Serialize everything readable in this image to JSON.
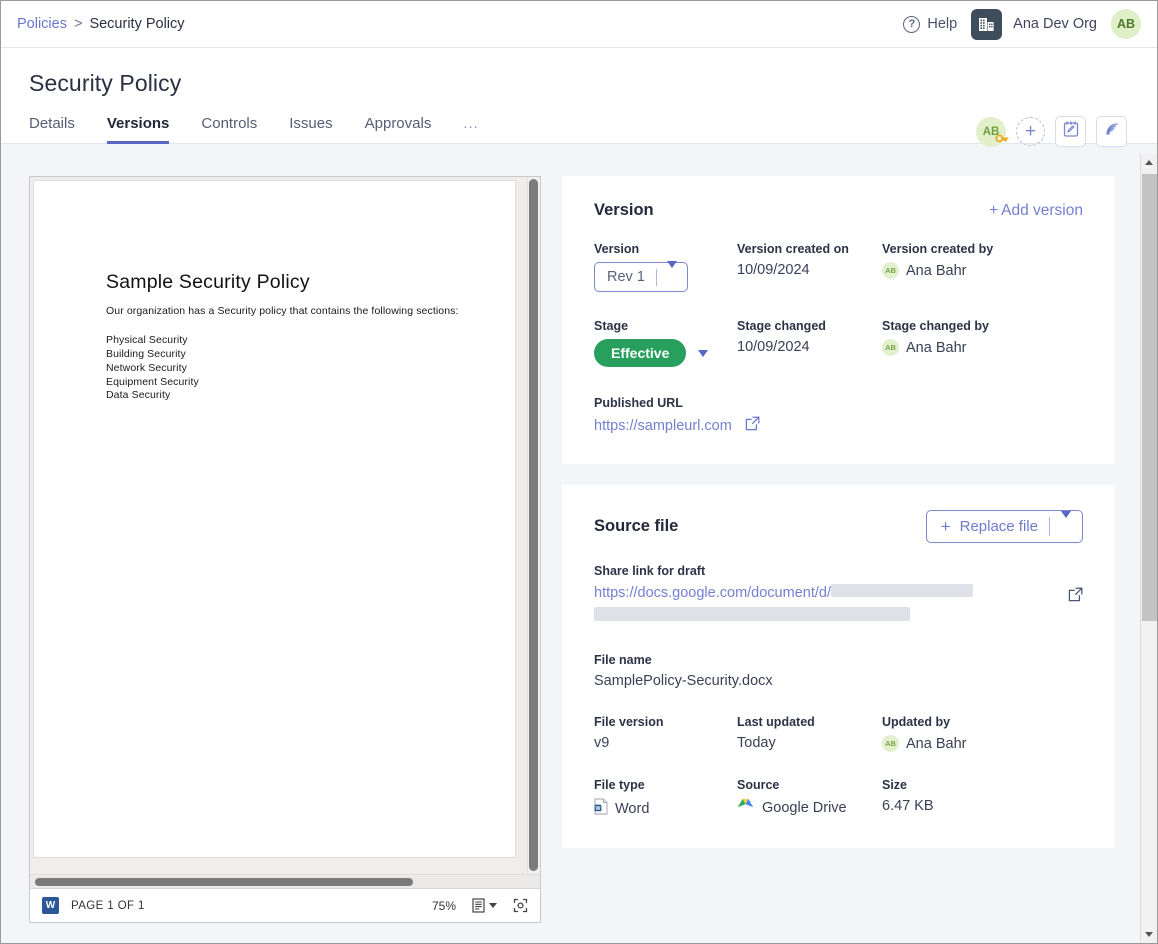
{
  "topbar": {
    "breadcrumb_parent": "Policies",
    "breadcrumb_sep": ">",
    "breadcrumb_current": "Security Policy",
    "help_label": "Help",
    "help_icon": "question-circle-icon",
    "org_icon": "building-icon",
    "org_name": "Ana Dev Org",
    "user_avatar_initials": "AB"
  },
  "page": {
    "title": "Security Policy",
    "actions": {
      "owner_avatar_initials": "AB",
      "owner_key_icon": "key-icon",
      "add_icon": "plus-icon",
      "notes_icon": "clipboard-note-icon",
      "feed_icon": "rss-broadcast-icon"
    },
    "tabs": [
      {
        "label": "Details",
        "active": false
      },
      {
        "label": "Versions",
        "active": true
      },
      {
        "label": "Controls",
        "active": false
      },
      {
        "label": "Issues",
        "active": false
      },
      {
        "label": "Approvals",
        "active": false
      },
      {
        "label": "...",
        "active": false
      }
    ]
  },
  "viewer": {
    "document": {
      "heading": "Sample Security Policy",
      "intro": "Our organization has a Security policy that contains the following sections:",
      "sections": [
        "Physical Security",
        "Building Security",
        "Network Security",
        "Equipment Security",
        "Data Security"
      ]
    },
    "footer": {
      "file_icon": "word-file-icon",
      "page_indicator": "PAGE 1 OF 1",
      "zoom": "75%",
      "layout_icon": "page-layout-icon",
      "fullscreen_icon": "fit-page-icon"
    }
  },
  "version_card": {
    "title": "Version",
    "add_version_label": "Add version",
    "add_version_icon": "plus-icon",
    "fields": {
      "version_label": "Version",
      "version_value": "Rev 1",
      "version_created_on_label": "Version created on",
      "version_created_on_value": "10/09/2024",
      "version_created_by_label": "Version created by",
      "version_created_by_value": "Ana Bahr",
      "version_created_by_initials": "AB",
      "stage_label": "Stage",
      "stage_value": "Effective",
      "stage_changed_label": "Stage changed",
      "stage_changed_value": "10/09/2024",
      "stage_changed_by_label": "Stage changed by",
      "stage_changed_by_value": "Ana Bahr",
      "stage_changed_by_initials": "AB",
      "published_url_label": "Published URL",
      "published_url_value": "https://sampleurl.com",
      "published_url_external_icon": "external-link-icon"
    },
    "colors": {
      "stage_badge": "#27a05e",
      "accent": "#7481d0"
    }
  },
  "source_file_card": {
    "title": "Source file",
    "replace_file_label": "Replace file",
    "replace_file_icon": "plus-icon",
    "share_link_label": "Share link for draft",
    "share_link_value": "https://docs.google.com/document/d/",
    "share_link_external_icon": "external-link-icon",
    "file_name_label": "File name",
    "file_name_value": "SamplePolicy-Security.docx",
    "file_version_label": "File version",
    "file_version_value": "v9",
    "last_updated_label": "Last updated",
    "last_updated_value": "Today",
    "updated_by_label": "Updated by",
    "updated_by_value": "Ana Bahr",
    "updated_by_initials": "AB",
    "file_type_label": "File type",
    "file_type_value": "Word",
    "file_type_icon": "word-file-icon",
    "source_label": "Source",
    "source_value": "Google Drive",
    "source_icon": "google-drive-icon",
    "size_label": "Size",
    "size_value": "6.47 KB"
  }
}
